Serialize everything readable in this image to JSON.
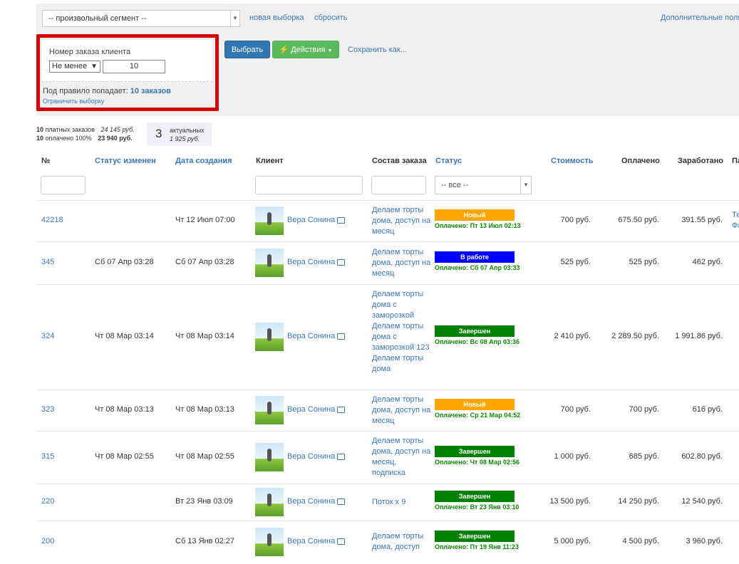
{
  "toolbar": {
    "segment": "-- произвольный сегмент --",
    "new_selection": "новая выборка",
    "reset": "сбросить",
    "extra": "Дополнительные поля"
  },
  "filter": {
    "title": "Номер заказа клиента",
    "operator": "Не менее",
    "value": "10",
    "rule_prefix": "Под правило попадает:",
    "rule_count": "10 заказов",
    "limit_link": "Ограничить выборку"
  },
  "buttons": {
    "select": "Выбрать",
    "actions": "Действия",
    "save_as": "Сохранить как..."
  },
  "stats": {
    "paid_count": "10",
    "paid_label": "платных заказов",
    "paid_sum": "24 145 руб.",
    "paid100_count": "10",
    "paid100_label": "оплачено 100%",
    "paid100_sum": "23 940 руб.",
    "actual_count": "3",
    "actual_label": "актуальных",
    "actual_sum": "1 925 руб."
  },
  "columns": {
    "num": "№",
    "status_changed": "Статус изменен",
    "created": "Дата создания",
    "client": "Клиент",
    "composition": "Состав заказа",
    "status": "Статус",
    "cost": "Стоимость",
    "paid": "Оплачено",
    "earned": "Заработано",
    "partner": "Па"
  },
  "status_filter": "-- все --",
  "colors": {
    "new": "#ffa500",
    "work": "#0000ff",
    "done": "#008000",
    "link": "#3a75b7",
    "highlight": "#d4000a"
  },
  "rows": [
    {
      "num": "42218",
      "changed": "",
      "created": "Чт 12 Июл 07:00",
      "client": "Вера Сонина",
      "comp": "Делаем торты дома, доступ на месяц",
      "status": "Новый",
      "status_color": "#ffa500",
      "paid_note": "Оплачено: Пт 13 Июл 02:13",
      "cost": "700 руб.",
      "paid": "675.50 руб.",
      "earned": "391.55 руб.",
      "partner": "Те Фа"
    },
    {
      "num": "345",
      "changed": "Сб 07 Апр 03:28",
      "created": "Сб 07 Апр 03:28",
      "client": "Вера Сонина",
      "comp": "Делаем торты дома, доступ на месяц",
      "status": "В работе",
      "status_color": "#0000ff",
      "paid_note": "Оплачено: Сб 07 Апр 03:33",
      "cost": "525 руб.",
      "paid": "525 руб.",
      "earned": "462 руб.",
      "partner": ""
    },
    {
      "num": "324",
      "changed": "Чт 08 Мар 03:14",
      "created": "Чт 08 Мар 03:14",
      "client": "Вера Сонина",
      "comp": "Делаем торты дома с заморозкой Делаем торты дома с заморозкой 123 Делаем торты дома",
      "status": "Завершен",
      "status_color": "#008000",
      "paid_note": "Оплачено: Вс 08 Апр 03:36",
      "cost": "2 410 руб.",
      "paid": "2 289.50 руб.",
      "earned": "1 991.86 руб.",
      "partner": ""
    },
    {
      "num": "323",
      "changed": "Чт 08 Мар 03:13",
      "created": "Чт 08 Мар 03:13",
      "client": "Вера Сонина",
      "comp": "Делаем торты дома, доступ на месяц",
      "status": "Новый",
      "status_color": "#ffa500",
      "paid_note": "Оплачено: Ср 21 Мар 04:52",
      "cost": "700 руб.",
      "paid": "700 руб.",
      "earned": "616 руб.",
      "partner": ""
    },
    {
      "num": "315",
      "changed": "Чт 08 Мар 02:55",
      "created": "Чт 08 Мар 02:55",
      "client": "Вера Сонина",
      "comp": "Делаем торты дома, доступ на месяц, подписка",
      "status": "Завершен",
      "status_color": "#008000",
      "paid_note": "Оплачено: Чт 08 Мар 02:56",
      "cost": "1 000 руб.",
      "paid": "685 руб.",
      "earned": "602.80 руб.",
      "partner": ""
    },
    {
      "num": "220",
      "changed": "",
      "created": "Вт 23 Янв 03:09",
      "client": "Вера Сонина",
      "comp": "Поток х 9",
      "status": "Завершен",
      "status_color": "#008000",
      "paid_note": "Оплачено: Вт 23 Янв 03:10",
      "cost": "13 500 руб.",
      "paid": "14 250 руб.",
      "earned": "12 540 руб.",
      "partner": ""
    },
    {
      "num": "200",
      "changed": "",
      "created": "Сб 13 Янв 02:27",
      "client": "Вера Сонина",
      "comp": "Делаем торты дома, доступ",
      "status": "Завершен",
      "status_color": "#008000",
      "paid_note": "Оплачено: Пт 19 Янв 11:23",
      "cost": "5 000 руб.",
      "paid": "4 500 руб.",
      "earned": "3 960 руб.",
      "partner": ""
    }
  ]
}
